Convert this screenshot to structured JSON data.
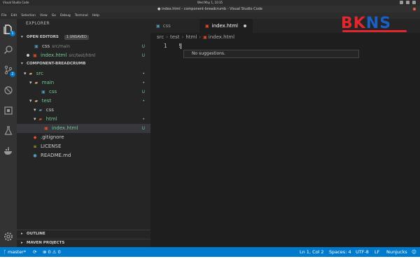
{
  "os_bar": {
    "app_name": "Visual Studio Code",
    "clock": "Wed May 1, 10:35"
  },
  "window": {
    "title": "● index.html - component-breadcrumb - Visual Studio Code"
  },
  "menu": [
    "File",
    "Edit",
    "Selection",
    "View",
    "Go",
    "Debug",
    "Terminal",
    "Help"
  ],
  "activity_bar": {
    "explorer_badge": "1",
    "scm_badge": "2",
    "icons": [
      "files-icon",
      "search-icon",
      "source-control-icon",
      "debug-icon",
      "extensions-icon",
      "test-flask-icon",
      "docker-icon",
      "settings-gear-icon"
    ]
  },
  "sidebar": {
    "title": "EXPLORER",
    "open_editors": {
      "label": "OPEN EDITORS",
      "badge": "1 UNSAVED",
      "items": [
        {
          "name": "css",
          "path": "src/main",
          "status": "U"
        },
        {
          "name": "index.html",
          "path": "src/test/html",
          "status": "U"
        }
      ]
    },
    "project": {
      "label": "COMPONENT-BREADCRUMB",
      "tree": [
        {
          "name": "src",
          "status": "•"
        },
        {
          "name": "main",
          "status": "•"
        },
        {
          "name": "css",
          "status": "U"
        },
        {
          "name": "test",
          "status": "•"
        },
        {
          "name": "css",
          "status": ""
        },
        {
          "name": "html",
          "status": "•"
        },
        {
          "name": "index.html",
          "status": "U"
        },
        {
          "name": ".gitignore",
          "status": ""
        },
        {
          "name": "LICENSE",
          "status": ""
        },
        {
          "name": "README.md",
          "status": ""
        }
      ]
    },
    "outline_label": "OUTLINE",
    "maven_label": "MAVEN PROJECTS"
  },
  "tabs": [
    {
      "label": "css",
      "active": false
    },
    {
      "label": "index.html",
      "active": true,
      "modified": true
    }
  ],
  "breadcrumb": [
    "src",
    "test",
    "html",
    "index.html"
  ],
  "editor": {
    "line_number": "1",
    "content": "!",
    "suggestion_text": "No suggestions."
  },
  "logo": {
    "text_part1": "BK",
    "text_part2": "NS"
  },
  "status_bar": {
    "branch": "master*",
    "sync": "⟳",
    "errors": "0",
    "warnings": "0",
    "position": "Ln 1, Col 2",
    "spaces": "Spaces: 4",
    "encoding": "UTF-8",
    "eol": "LF",
    "language": "Nunjucks",
    "accent_color": "#007acc"
  }
}
